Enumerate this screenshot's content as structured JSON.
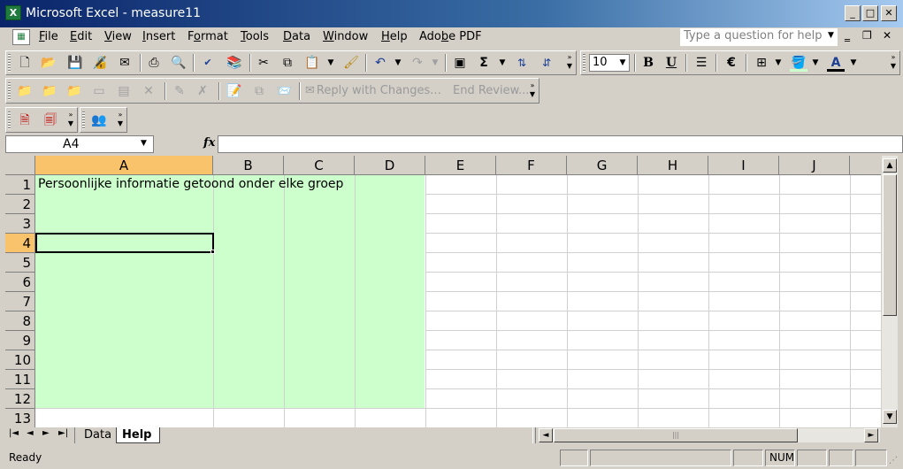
{
  "window": {
    "title": "Microsoft Excel - measure11",
    "app_icon": "X",
    "controls": {
      "minimize": "_",
      "maximize": "□",
      "close": "✕"
    }
  },
  "menubar": {
    "items": [
      {
        "label": "File",
        "ul": "F",
        "rest": "ile"
      },
      {
        "label": "Edit",
        "ul": "E",
        "rest": "dit"
      },
      {
        "label": "View",
        "ul": "V",
        "rest": "iew"
      },
      {
        "label": "Insert",
        "ul": "I",
        "rest": "nsert"
      },
      {
        "label": "Format",
        "ul": "o",
        "pre": "F",
        "rest": "rmat"
      },
      {
        "label": "Tools",
        "ul": "T",
        "rest": "ools"
      },
      {
        "label": "Data",
        "ul": "D",
        "rest": "ata"
      },
      {
        "label": "Window",
        "ul": "W",
        "rest": "indow"
      },
      {
        "label": "Help",
        "ul": "H",
        "rest": "elp"
      },
      {
        "label": "Adobe PDF",
        "ul": "b",
        "pre": "Ado",
        "rest": "e PDF"
      }
    ],
    "help_placeholder": "Type a question for help",
    "doc_controls": {
      "minimize": "‗",
      "restore": "❐",
      "close": "✕"
    }
  },
  "standard_toolbar": {
    "font_size": "10",
    "bold": "B",
    "underline": "U",
    "euro": "€",
    "font_color": "A",
    "autosum": "Σ"
  },
  "reviewing_toolbar": {
    "reply_label": "Reply with Changes...",
    "end_review_label": "End Review..."
  },
  "formula_bar": {
    "name_box": "A4",
    "fx": "fx",
    "value": ""
  },
  "sheet": {
    "columns": [
      "A",
      "B",
      "C",
      "D",
      "E",
      "F",
      "G",
      "H",
      "I",
      "J"
    ],
    "rows": [
      "1",
      "2",
      "3",
      "4",
      "5",
      "6",
      "7",
      "8",
      "9",
      "10",
      "11",
      "12",
      "13"
    ],
    "active_cell": "A4",
    "cells": {
      "A1": "Persoonlijke informatie getoond onder elke groep"
    },
    "fill_color": "#ccffcc",
    "active_header_color": "#f9c36b"
  },
  "tabs": {
    "nav": [
      "|◄",
      "◄",
      "►",
      "►|"
    ],
    "sheets": [
      {
        "label": "Data",
        "active": false
      },
      {
        "label": "Help",
        "active": true
      }
    ]
  },
  "statusbar": {
    "status": "Ready",
    "num": "NUM"
  }
}
